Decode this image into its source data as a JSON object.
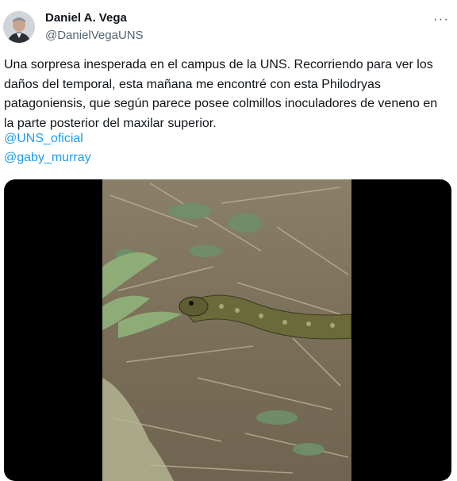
{
  "author": {
    "name": "Daniel A. Vega",
    "handle": "@DanielVegaUNS"
  },
  "tweet": {
    "text": "Una sorpresa inesperada en el campus de la UNS. Recorriendo para ver los daños del temporal, esta mañana me encontré con esta Philodryas patagoniensis, que según parece posee colmillos inoculadores de veneno en la parte posterior del maxilar superior.",
    "mentions": [
      "@UNS_oficial",
      "@gaby_murray"
    ]
  },
  "icons": {
    "more": "more-horizontal-icon",
    "avatar": "profile-photo"
  },
  "colors": {
    "link": "#1d9bf0",
    "text": "#0f1419",
    "secondary": "#536471",
    "media_bg": "#000000"
  }
}
